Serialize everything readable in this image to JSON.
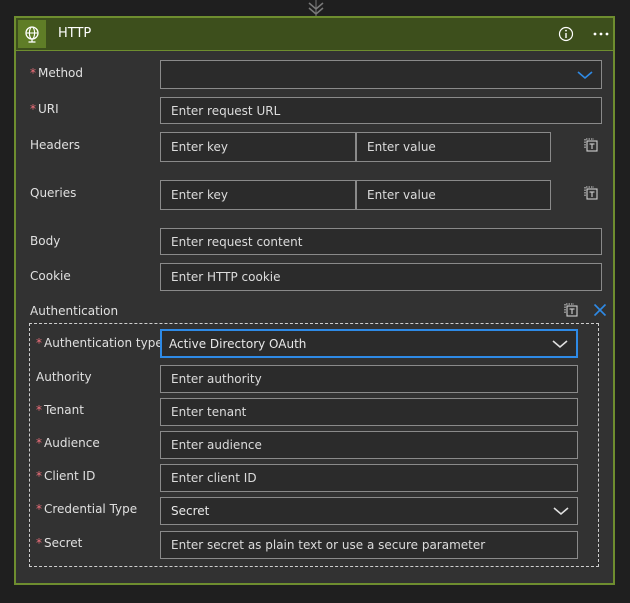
{
  "card": {
    "title": "HTTP",
    "icons": {
      "action": "globe-icon",
      "info": "info-icon",
      "more": "more-icon"
    }
  },
  "fields": {
    "method": {
      "label": "Method",
      "value": ""
    },
    "uri": {
      "label": "URI",
      "placeholder": "Enter request URL"
    },
    "headers": {
      "label": "Headers",
      "key_placeholder": "Enter key",
      "value_placeholder": "Enter value"
    },
    "queries": {
      "label": "Queries",
      "key_placeholder": "Enter key",
      "value_placeholder": "Enter value"
    },
    "body": {
      "label": "Body",
      "placeholder": "Enter request content"
    },
    "cookie": {
      "label": "Cookie",
      "placeholder": "Enter HTTP cookie"
    }
  },
  "authentication": {
    "label": "Authentication",
    "type": {
      "label": "Authentication type",
      "value": "Active Directory OAuth"
    },
    "authority": {
      "label": "Authority",
      "placeholder": "Enter authority"
    },
    "tenant": {
      "label": "Tenant",
      "placeholder": "Enter tenant"
    },
    "audience": {
      "label": "Audience",
      "placeholder": "Enter audience"
    },
    "client_id": {
      "label": "Client ID",
      "placeholder": "Enter client ID"
    },
    "credential_type": {
      "label": "Credential Type",
      "value": "Secret"
    },
    "secret": {
      "label": "Secret",
      "placeholder": "Enter secret as plain text or use a secure parameter"
    }
  },
  "colors": {
    "card_border": "#6e8d2f",
    "header_bg": "#3d4f1c",
    "required_asterisk": "#f1707b",
    "accent_blue": "#2e8ae6"
  }
}
